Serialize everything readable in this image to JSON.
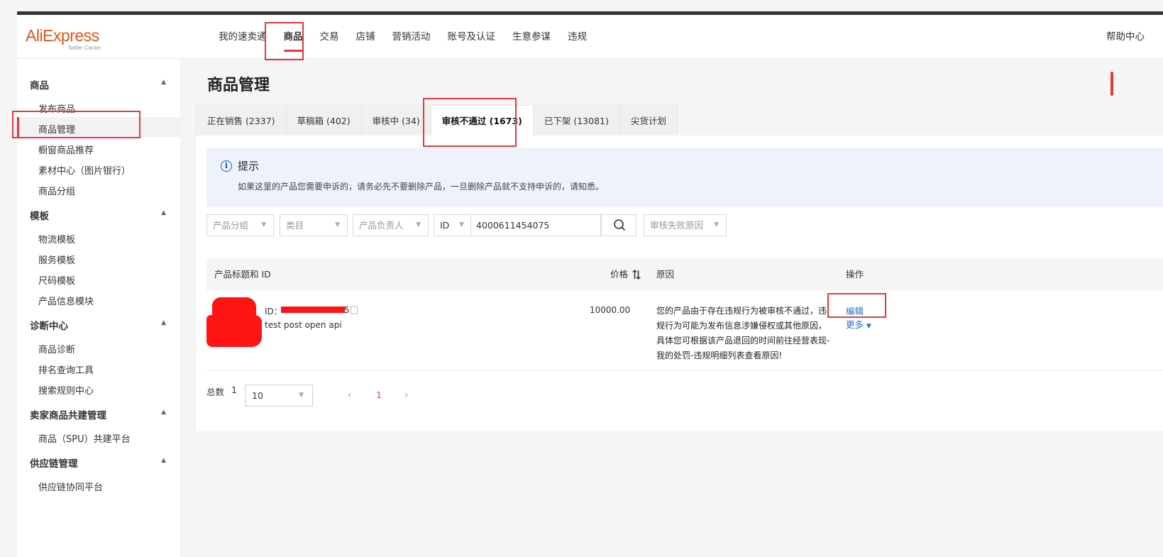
{
  "logo": {
    "brand": "AliExpress",
    "sub": "Seller Center"
  },
  "nav": {
    "items": [
      "我的速卖通",
      "商品",
      "交易",
      "店铺",
      "营销活动",
      "账号及认证",
      "生意参谋",
      "违规"
    ],
    "active": "商品",
    "help": "帮助中心"
  },
  "sidebar": {
    "groups": [
      {
        "title": "商品",
        "items": [
          "发布商品",
          "商品管理",
          "橱窗商品推荐",
          "素材中心（图片银行）",
          "商品分组"
        ]
      },
      {
        "title": "模板",
        "items": [
          "物流模板",
          "服务模板",
          "尺码模板",
          "产品信息模块"
        ]
      },
      {
        "title": "诊断中心",
        "items": [
          "商品诊断",
          "排名查询工具",
          "搜索规则中心"
        ]
      },
      {
        "title": "卖家商品共建管理",
        "items": [
          "商品（SPU）共建平台"
        ]
      },
      {
        "title": "供应链管理",
        "items": [
          "供应链协同平台"
        ]
      }
    ],
    "active_item": "商品管理",
    "caret": "▲"
  },
  "page": {
    "title": "商品管理"
  },
  "tabs": [
    "正在销售 (2337)",
    "草稿箱 (402)",
    "审核中 (34)",
    "审核不通过 (1673)",
    "已下架 (13081)",
    "尖货计划"
  ],
  "active_tab": "审核不通过 (1673)",
  "notice": {
    "icon": "info-icon",
    "title": "提示",
    "text": "如果这里的产品您需要申诉的，请务必先不要删除产品，一旦删除产品就不支持申诉的，请知悉。"
  },
  "filters": {
    "group": "产品分组",
    "category": "类目",
    "owner": "产品负责人",
    "id_type": "ID",
    "id_value": "4000611454075",
    "fail_reason": "审核失败原因"
  },
  "table": {
    "headers": {
      "title": "产品标题和 ID",
      "price": "价格",
      "reason": "原因",
      "action": "操作"
    },
    "rows": [
      {
        "id_label": "ID：",
        "id_tail": "5",
        "name": "test post open api",
        "price": "10000.00",
        "reason": "您的产品由于存在违规行为被审核不通过，违规行为可能为发布信息涉嫌侵权或其他原因，具体您可根据该产品退回的时间前往经营表现-我的处罚-违规明细列表查看原因!",
        "edit": "编辑",
        "more": "更多"
      }
    ]
  },
  "pagination": {
    "total_label": "总数",
    "total": "1",
    "page_size": "10",
    "prev": "‹",
    "current": "1",
    "next": "›"
  },
  "colors": {
    "accent": "#e4393c",
    "brand": "#e8521b",
    "link": "#1f72c7",
    "notice_bg": "#eef3fb"
  }
}
